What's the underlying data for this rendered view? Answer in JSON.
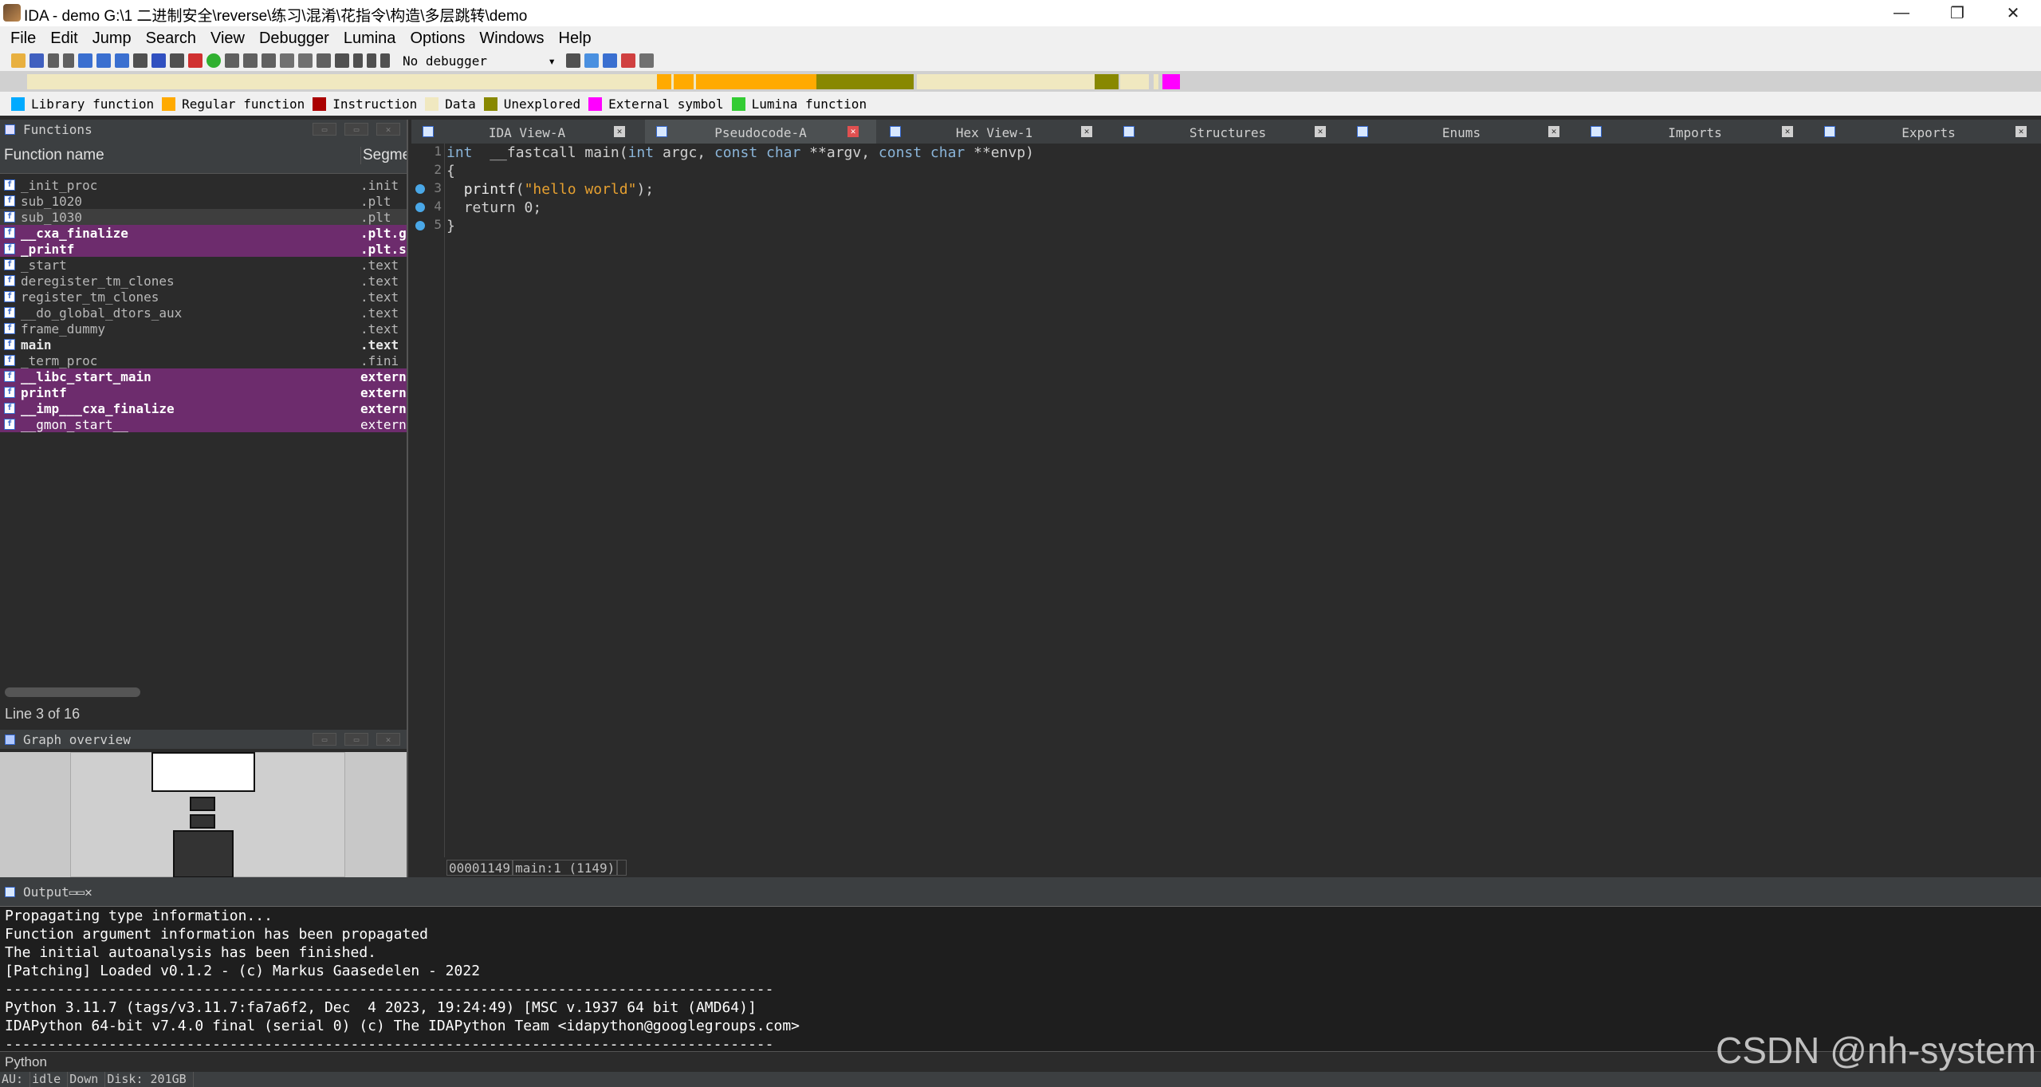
{
  "window": {
    "title": "IDA - demo G:\\1 二进制安全\\reverse\\练习\\混淆\\花指令\\构造\\多层跳转\\demo",
    "minimize": "—",
    "restore": "❐",
    "close": "✕"
  },
  "menu": [
    "File",
    "Edit",
    "Jump",
    "Search",
    "View",
    "Debugger",
    "Lumina",
    "Options",
    "Windows",
    "Help"
  ],
  "toolbar": {
    "debugger": "No debugger"
  },
  "legend": [
    {
      "label": "Library function",
      "color": "#00aaff"
    },
    {
      "label": "Regular function",
      "color": "#ffaa00"
    },
    {
      "label": "Instruction",
      "color": "#aa0000"
    },
    {
      "label": "Data",
      "color": "#f0e8c0"
    },
    {
      "label": "Unexplored",
      "color": "#888800"
    },
    {
      "label": "External symbol",
      "color": "#ff00ff"
    },
    {
      "label": "Lumina function",
      "color": "#33cc33"
    }
  ],
  "functions": {
    "title": "Functions",
    "col_name": "Function name",
    "col_segment": "Segment",
    "rows": [
      {
        "name": "_init_proc",
        "seg": ".init",
        "style": "plain"
      },
      {
        "name": "sub_1020",
        "seg": ".plt",
        "style": "plain"
      },
      {
        "name": "sub_1030",
        "seg": ".plt",
        "style": "sel"
      },
      {
        "name": "__cxa_finalize",
        "seg": ".plt.got",
        "style": "ext-bold"
      },
      {
        "name": "_printf",
        "seg": ".plt.sec",
        "style": "ext-bold"
      },
      {
        "name": "_start",
        "seg": ".text",
        "style": "plain"
      },
      {
        "name": "deregister_tm_clones",
        "seg": ".text",
        "style": "plain"
      },
      {
        "name": "register_tm_clones",
        "seg": ".text",
        "style": "plain"
      },
      {
        "name": "__do_global_dtors_aux",
        "seg": ".text",
        "style": "plain"
      },
      {
        "name": "frame_dummy",
        "seg": ".text",
        "style": "plain"
      },
      {
        "name": "main",
        "seg": ".text",
        "style": "bold"
      },
      {
        "name": "_term_proc",
        "seg": ".fini",
        "style": "plain"
      },
      {
        "name": "__libc_start_main",
        "seg": "extern",
        "style": "ext-bold"
      },
      {
        "name": "printf",
        "seg": "extern",
        "style": "ext-bold"
      },
      {
        "name": "__imp___cxa_finalize",
        "seg": "extern",
        "style": "ext-bold"
      },
      {
        "name": "__gmon_start__",
        "seg": "extern",
        "style": "ext"
      }
    ],
    "status": "Line 3 of 16"
  },
  "graph_overview": {
    "title": "Graph overview"
  },
  "tabs": [
    {
      "label": "IDA View-A",
      "active": false
    },
    {
      "label": "Pseudocode-A",
      "active": true
    },
    {
      "label": "Hex View-1",
      "active": false
    },
    {
      "label": "Structures",
      "active": false
    },
    {
      "label": "Enums",
      "active": false
    },
    {
      "label": "Imports",
      "active": false
    },
    {
      "label": "Exports",
      "active": false
    }
  ],
  "code": {
    "lines": [
      {
        "num": "1",
        "bp": false,
        "tokens": [
          [
            "kw",
            "int"
          ],
          [
            "",
            "  __fastcall main("
          ],
          [
            "kw",
            "int"
          ],
          [
            "",
            " argc, "
          ],
          [
            "kw",
            "const char"
          ],
          [
            "",
            " **argv, "
          ],
          [
            "kw",
            "const char"
          ],
          [
            "",
            " **envp)"
          ]
        ]
      },
      {
        "num": "2",
        "bp": false,
        "tokens": [
          [
            "",
            "{"
          ]
        ]
      },
      {
        "num": "3",
        "bp": true,
        "tokens": [
          [
            "",
            "  "
          ],
          [
            "fnc",
            "printf"
          ],
          [
            "",
            "("
          ],
          [
            "str",
            "\"hello world\""
          ],
          [
            "",
            ");"
          ]
        ]
      },
      {
        "num": "4",
        "bp": true,
        "tokens": [
          [
            "",
            "  "
          ],
          [
            "",
            "return 0;"
          ]
        ]
      },
      {
        "num": "5",
        "bp": true,
        "tokens": [
          [
            "",
            "}"
          ]
        ]
      }
    ],
    "status_addr": "00001149",
    "status_loc": "main:1 (1149)"
  },
  "output": {
    "title": "Output",
    "lines": [
      "Propagating type information...",
      "Function argument information has been propagated",
      "The initial autoanalysis has been finished.",
      "[Patching] Loaded v0.1.2 - (c) Markus Gaasedelen - 2022",
      "-----------------------------------------------------------------------------------------",
      "Python 3.11.7 (tags/v3.11.7:fa7a6f2, Dec  4 2023, 19:24:49) [MSC v.1937 64 bit (AMD64)]",
      "IDAPython 64-bit v7.4.0 final (serial 0) (c) The IDAPython Team <idapython@googlegroups.com>",
      "-----------------------------------------------------------------------------------------"
    ]
  },
  "python_bar": "Python",
  "statusbar": {
    "au": "AU:",
    "state": "idle",
    "dir": "Down",
    "disk": "Disk: 201GB"
  },
  "watermark": "CSDN @nh-system"
}
